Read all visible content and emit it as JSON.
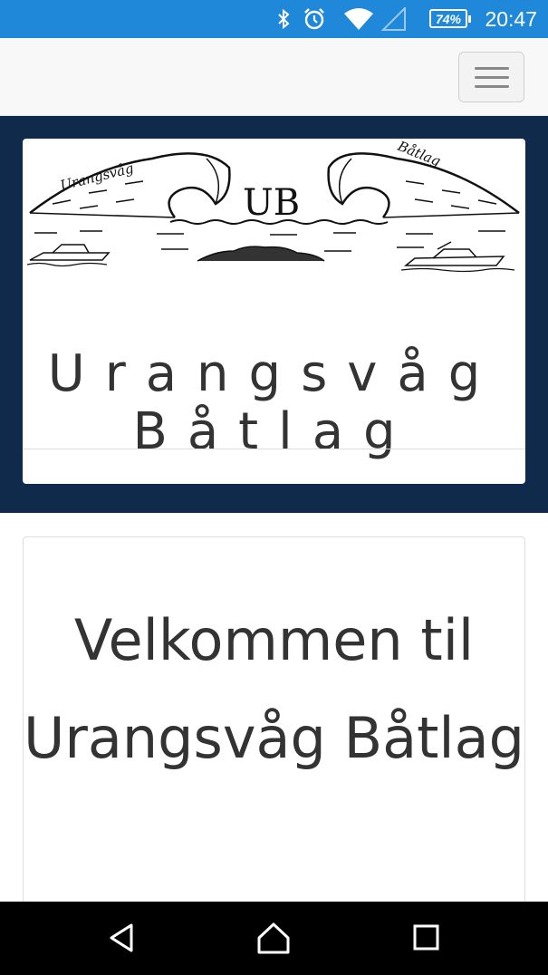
{
  "status_bar": {
    "time": "20:47",
    "battery": "74%",
    "icons": [
      "bluetooth-icon",
      "alarm-icon",
      "wifi-icon",
      "cell-signal-icon",
      "battery-icon"
    ],
    "background": "#1f88d8"
  },
  "navbar": {
    "menu_icon": "hamburger-menu-icon",
    "background": "#f8f8f8"
  },
  "hero": {
    "background": "#0f2a4a",
    "logo": {
      "left_text": "Urangsvåg",
      "right_text": "Båtlag",
      "monogram": "UB"
    },
    "title": "Urangsvåg Båtlag"
  },
  "welcome": {
    "title": "Velkommen til Urangsvåg Båtlag"
  },
  "system_nav": {
    "icons": [
      "back-icon",
      "home-icon",
      "recents-icon"
    ]
  }
}
